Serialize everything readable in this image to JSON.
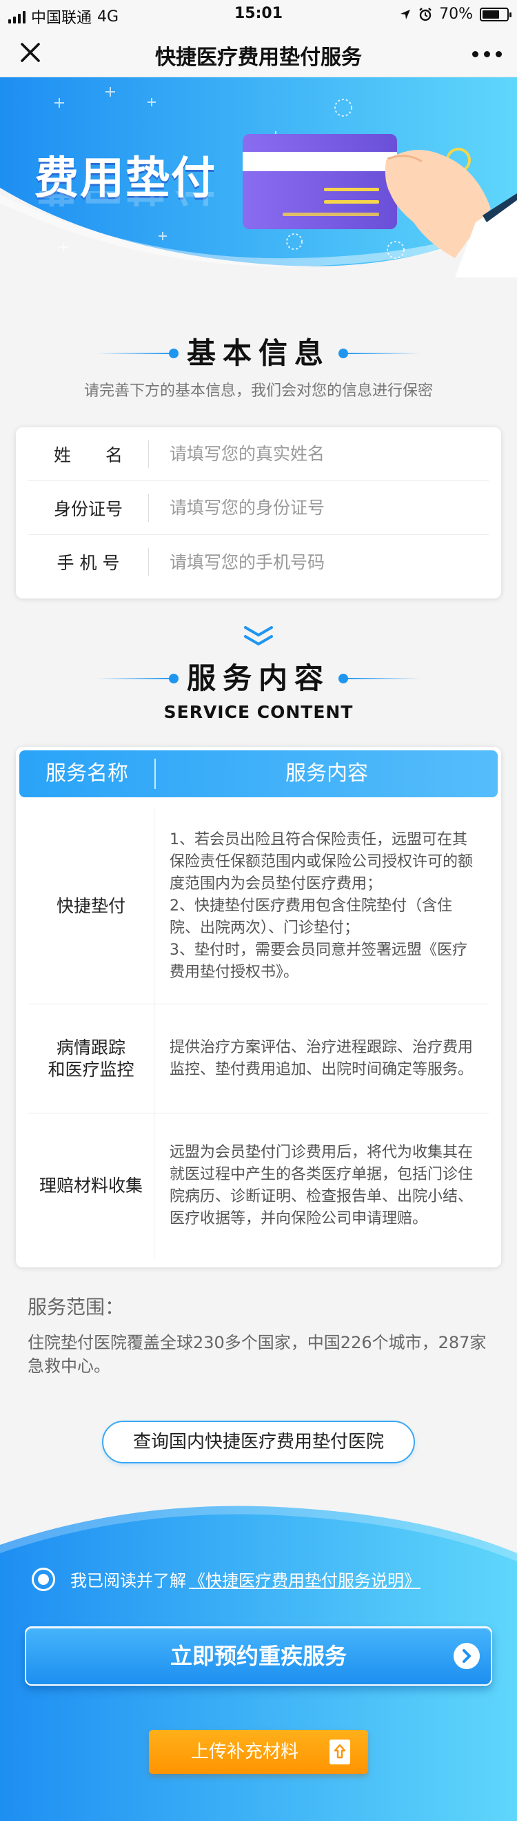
{
  "status_bar": {
    "carrier": "中国联通",
    "network": "4G",
    "time": "15:01",
    "battery": "70%",
    "battery_level": 0.7
  },
  "nav": {
    "title": "快捷医疗费用垫付服务"
  },
  "banner": {
    "title": "费用垫付"
  },
  "basic_info": {
    "title": "基本信息",
    "subtitle": "请完善下方的基本信息，我们会对您的信息进行保密",
    "fields": [
      {
        "label": "姓　　名",
        "placeholder": "请填写您的真实姓名"
      },
      {
        "label": "身份证号",
        "placeholder": "请填写您的身份证号"
      },
      {
        "label": "手 机 号",
        "placeholder": "请填写您的手机号码"
      }
    ]
  },
  "service": {
    "title": "服务内容",
    "subtitle_en": "SERVICE CONTENT",
    "table_headers": [
      "服务名称",
      "服务内容"
    ],
    "rows": [
      {
        "name": "快捷垫付",
        "lines": [
          "1、若会员出险且符合保险责任，远盟可在其保险责任保额范围内或保险公司授权许可的额度范围内为会员垫付医疗费用；",
          "2、快捷垫付医疗费用包含住院垫付（含住院、出院两次）、门诊垫付；",
          "3、垫付时，需要会员同意并签署远盟《医疗费用垫付授权书》。"
        ]
      },
      {
        "name_line1": "病情跟踪",
        "name_line2": "和医疗监控",
        "lines": [
          "提供治疗方案评估、治疗进程跟踪、治疗费用监控、垫付费用追加、出院时间确定等服务。"
        ]
      },
      {
        "name": "理赔材料收集",
        "lines": [
          "远盟为会员垫付门诊费用后，将代为收集其在就医过程中产生的各类医疗单据，包括门诊住院病历、诊断证明、检查报告单、出院小结、医疗收据等，并向保险公司申请理赔。"
        ]
      }
    ]
  },
  "scope": {
    "title": "服务范围：",
    "text": "住院垫付医院覆盖全球230多个国家，中国226个城市，287家急救中心。"
  },
  "query_button": "查询国内快捷医疗费用垫付医院",
  "agreement": {
    "prefix": "我已阅读并了解",
    "link": "《快捷医疗费用垫付服务说明》"
  },
  "book_button": "立即预约重疾服务",
  "upload_button": "上传补充材料",
  "colors": {
    "primary_blue": "#1e96f0",
    "light_blue": "#55bdfb",
    "orange": "#ff9400"
  }
}
